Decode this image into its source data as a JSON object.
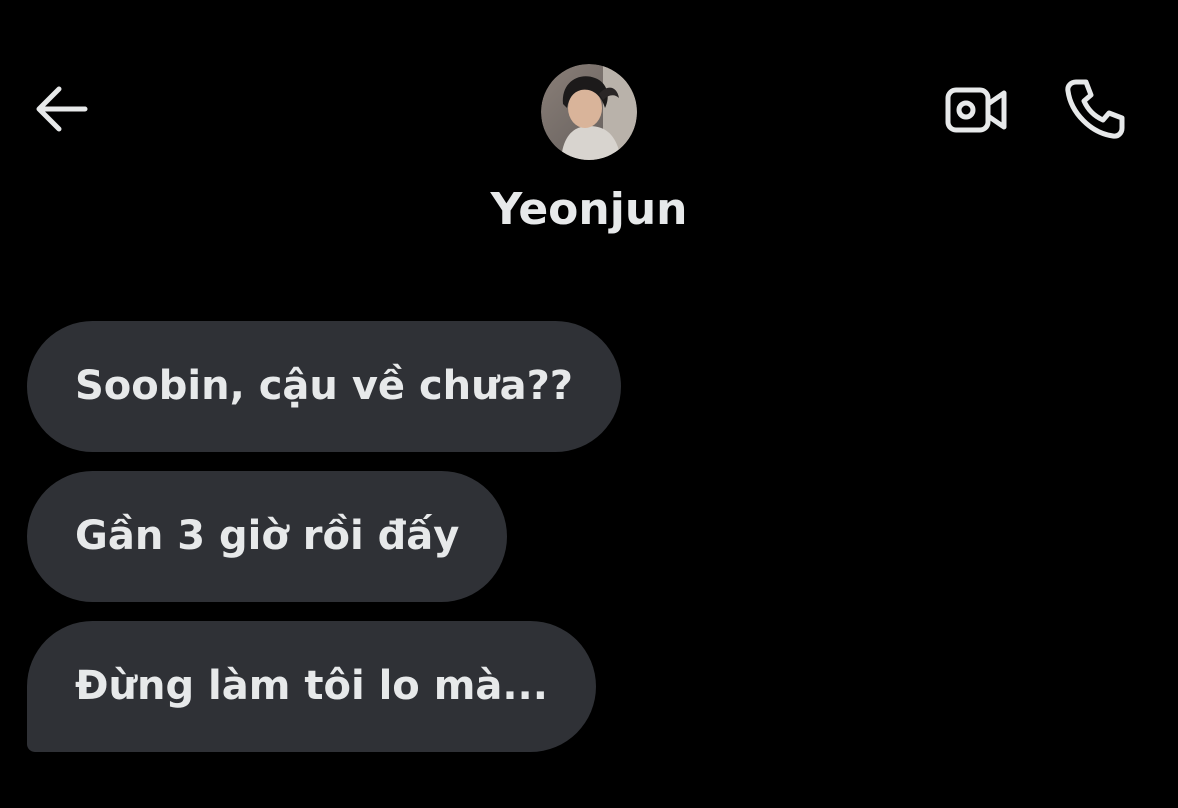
{
  "header": {
    "contact_name": "Yeonjun",
    "back_icon": "arrow-left-icon",
    "video_icon": "video-camera-icon",
    "call_icon": "phone-icon",
    "avatar": "contact-avatar-photo"
  },
  "messages": [
    {
      "text": "Soobin, cậu về chưa??",
      "direction": "incoming"
    },
    {
      "text": "Gần 3 giờ rồi đấy",
      "direction": "incoming"
    },
    {
      "text": "Đừng làm tôi lo mà...",
      "direction": "incoming"
    }
  ],
  "colors": {
    "background": "#000000",
    "bubble_incoming": "#2f3136",
    "text_primary": "#e7e9ea"
  }
}
